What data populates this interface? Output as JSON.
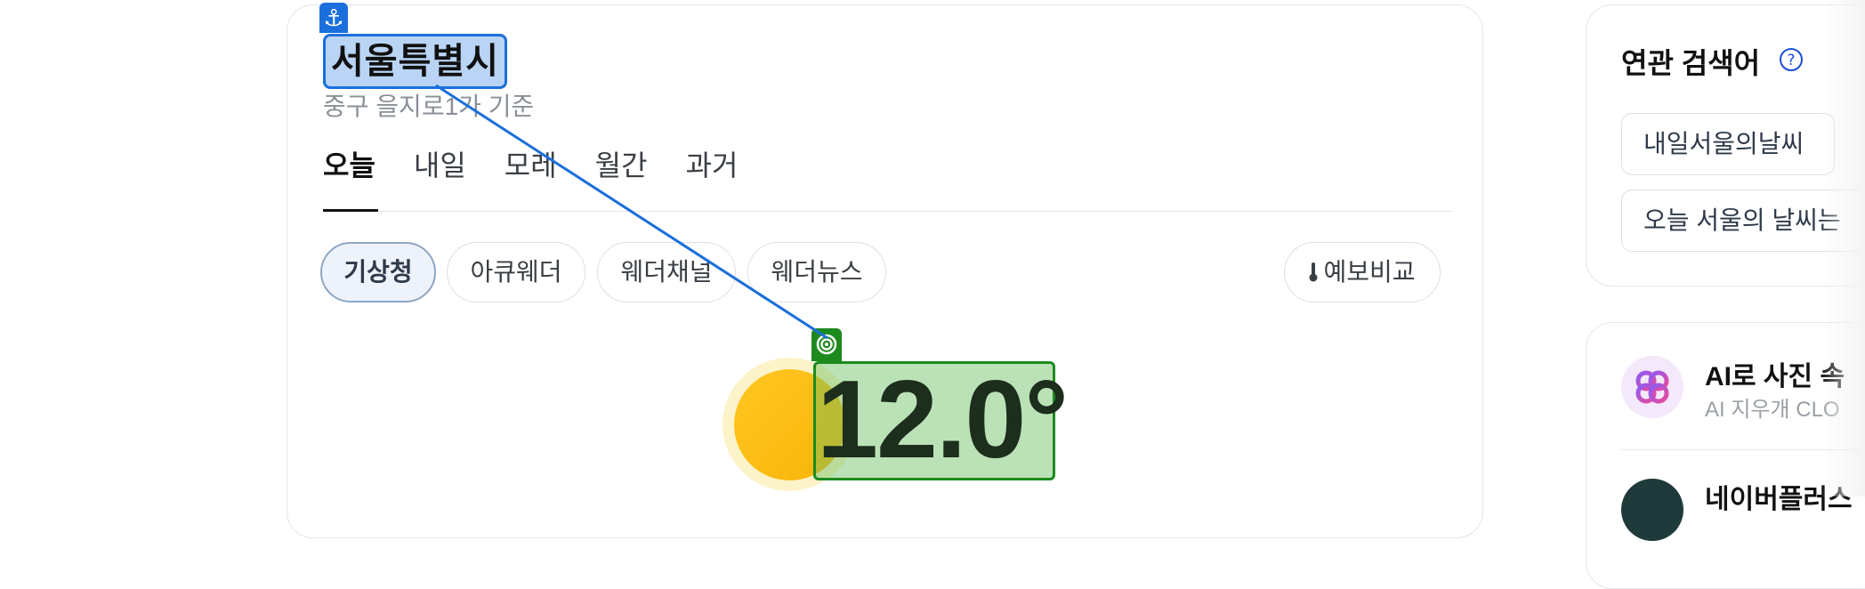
{
  "weather": {
    "city": "서울특별시",
    "location_sub": "중구 을지로1가 기준",
    "tabs": [
      {
        "label": "오늘"
      },
      {
        "label": "내일"
      },
      {
        "label": "모레"
      },
      {
        "label": "월간"
      },
      {
        "label": "과거"
      }
    ],
    "sources": [
      {
        "label": "기상청"
      },
      {
        "label": "아큐웨더"
      },
      {
        "label": "웨더채널"
      },
      {
        "label": "웨더뉴스"
      }
    ],
    "compare_label": "예보비교",
    "temperature": "12.0°",
    "condition_icon": "sun-icon"
  },
  "related": {
    "title": "연관 검색어",
    "items": [
      {
        "label": "내일서울의날씨"
      },
      {
        "label": "오늘 서울의 날씨는"
      }
    ]
  },
  "apps": {
    "ai_title": "AI로 사진 속",
    "ai_sub": "AI 지우개 CLO",
    "app2_title": "네이버플러스"
  },
  "overlay": {
    "anchor_icon": "anchor-icon",
    "target_icon": "target-icon",
    "source_color": "#1a6fdc",
    "target_color": "#1d8a1d"
  }
}
